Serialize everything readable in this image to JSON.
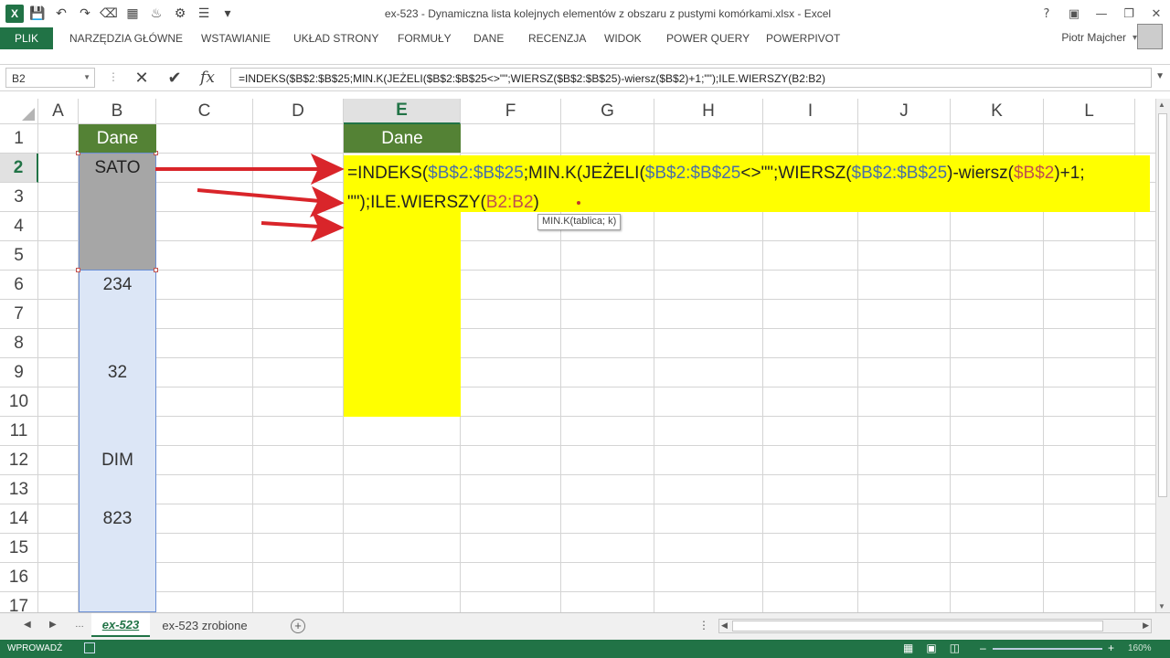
{
  "window": {
    "title": "ex-523 - Dynamiczna lista kolejnych elementów z obszaru z pustymi komórkami.xlsx - Excel",
    "app_logo": "X"
  },
  "qat": [
    "save-icon",
    "undo-icon",
    "redo-icon",
    "eraser-icon",
    "table-icon",
    "paint-icon",
    "tree-icon",
    "filter-icon",
    "more-icon"
  ],
  "ribbon": {
    "tabs": [
      "PLIK",
      "NARZĘDZIA GŁÓWNE",
      "WSTAWIANIE",
      "UKŁAD STRONY",
      "FORMUŁY",
      "DANE",
      "RECENZJA",
      "WIDOK",
      "POWER QUERY",
      "POWERPIVOT"
    ],
    "user": "Piotr Majcher"
  },
  "formula_bar": {
    "name_box": "B2",
    "fx_label": "fx",
    "formula": "=INDEKS($B$2:$B$25;MIN.K(JEŻELI($B$2:$B$25<>\"\";WIERSZ($B$2:$B$25)-wiersz($B$2)+1;\"\");ILE.WIERSZY(B2:B2)"
  },
  "grid": {
    "columns": [
      "A",
      "B",
      "C",
      "D",
      "E",
      "F",
      "G",
      "H",
      "I",
      "J",
      "K",
      "L"
    ],
    "selected_column": "E",
    "rows": [
      "1",
      "2",
      "3",
      "4",
      "5",
      "6",
      "7",
      "8",
      "9",
      "10",
      "11",
      "12",
      "13",
      "14",
      "15",
      "16",
      "17"
    ],
    "selected_row": "2",
    "b_header": "Dane",
    "e_header": "Dane",
    "b_values": {
      "b2": "SATO",
      "b6": "234",
      "b9": "32",
      "b12": "DIM",
      "b14": "823"
    },
    "edit_line1": {
      "p1": "=INDEKS(",
      "r1": "$B$2:$B$25",
      "p2": ";MIN.K(JEŻELI(",
      "r2": "$B$2:$B$25",
      "p3": "<>\"\";WIERSZ(",
      "r3": "$B$2:$B$25",
      "p4": ")-wiersz(",
      "r4": "$B$2",
      "p5": ")+1;"
    },
    "edit_line2": {
      "p1": "\"\");ILE.WIERSZY(",
      "r1": "B2:B2",
      "p2": ")"
    },
    "tooltip": "MIN.K(tablica; k)",
    "arrow_color": "#d9252a"
  },
  "sheets": {
    "tabs": [
      "ex-523",
      "ex-523 zrobione"
    ],
    "active": "ex-523"
  },
  "status": {
    "mode": "WPROWADŹ",
    "zoom": "160%"
  },
  "colors": {
    "excel_green": "#217346",
    "header_green": "#548235",
    "yellow": "#ffff00",
    "range_blue": "#dce6f6"
  }
}
